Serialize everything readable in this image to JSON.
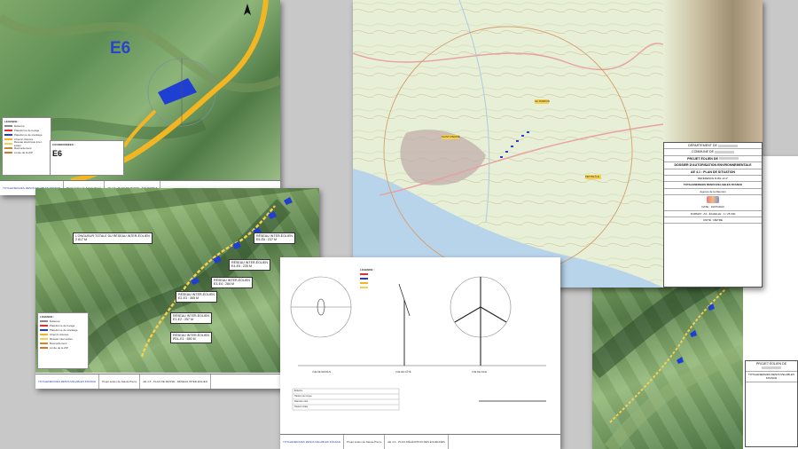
{
  "sheet_e6": {
    "label": "E6",
    "legend_title": "LÉGENDE :",
    "legend_items": [
      "Éolienne",
      "Plateforme de levage",
      "Plateforme de stockage",
      "Chemin d'accès",
      "Réseau électrique inter-éolien",
      "Raccordement",
      "Limite de la ZIP"
    ],
    "coords_title": "COORDONNÉES :",
    "coords_label": "E6",
    "footer_company": "TOTALENERGIES RENOUVELABLES FRANCE",
    "footer_project": "Projet éolien de Sainte-Pierre",
    "footer_doc": "AE 4.6 - PLAN DE MASSE - ÉOLIENNE 6"
  },
  "sheet_reseau": {
    "title": "L'ONGUEUR TOTALE DU RÉSEAU INTER-ÉOLIEN\n2 817 M",
    "boxes": [
      "RÉSEAU INTER-ÉOLIEN\nE5-E6 : 237 M",
      "RÉSEAU INTER-ÉOLIEN\nE4-E5 : 235 M",
      "RÉSEAU INTER-ÉOLIEN\nE3-E4 : 284 M",
      "RÉSEAU INTER-ÉOLIEN\nE2-E3 : 365 M",
      "RÉSEAU INTER-ÉOLIEN\nE1-E2 : 257 M",
      "RÉSEAU INTER-ÉOLIEN\nPDL-E1 : 650 M"
    ],
    "legend_title": "LÉGENDE :",
    "legend_items": [
      "Éolienne",
      "Plateforme de levage",
      "Plateforme de stockage",
      "Chemin d'accès",
      "Réseau inter-éolien",
      "Raccordement",
      "Limite de la ZIP"
    ],
    "footer_company": "TOTALENERGIES RENOUVELABLES FRANCE",
    "footer_project": "Projet éolien de Sainte-Pierre",
    "footer_doc": "AE 4.5 - PLAN DE MASSE - RÉSEAU INTER-ÉOLIEN"
  },
  "sheet_situation": {
    "towns": [
      "SAINT-PIERRE",
      "LE TAMPON",
      "PETITE ÎLE"
    ],
    "cartouche": {
      "departement": "DÉPARTEMENT DE",
      "commune": "COMMUNE DE",
      "projet": "PROJET ÉOLIEN DE",
      "dossier": "DOSSIER D'AUTORISATION ENVIRONNEMENTALE",
      "piece": "AE 4.1 : PLAN DE SITUATION",
      "reference": "RÉFÉRENCE R181-13 2°",
      "company": "TOTALENERGIES RENOUVELABLES FRANCE",
      "agency": "Agence de la Réunion",
      "format_label": "FORMAT : A3 - ÉCHELLE : 1 / 25 000",
      "unit_label": "UNITÉ : MÈTRE",
      "date_label": "DATE : 19/07/2023",
      "ind_label": "IND. : A"
    }
  },
  "sheet_turbine": {
    "legend_title": "LÉGENDE :",
    "view_labels": [
      "VUE DE DESSUS",
      "VUE DE FACE",
      "VUE DE CÔTÉ"
    ],
    "table_rows": [
      "Éolienne",
      "Hauteur de moyeu",
      "Diamètre rotor",
      "Hauteur totale"
    ],
    "footer_company": "TOTALENERGIES RENOUVELABLES FRANCE",
    "footer_project": "Projet éolien de Sainte-Pierre",
    "footer_doc": "AE 4.3 - PLAN D'ÉLÉVATION DES ÉOLIENNES"
  },
  "sheet_right": {
    "cartouche_project": "PROJET ÉOLIEN DE",
    "cartouche_company": "TOTALENERGIES RENOUVELABLES FRANCE"
  },
  "colors": {
    "road": "#f2b622",
    "platform": "#1e3fd1",
    "network": "#f5d050",
    "water": "#b8d4ea"
  }
}
